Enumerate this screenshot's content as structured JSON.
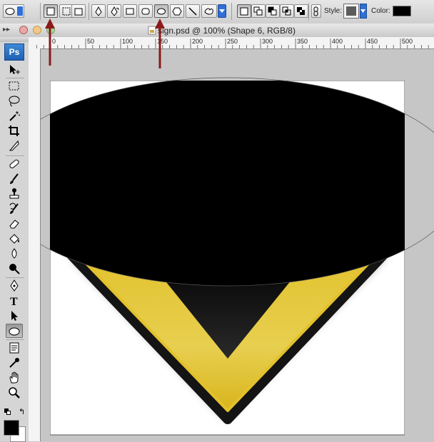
{
  "document": {
    "title": "sign.psd @ 100% (Shape 6, RGB/8)"
  },
  "options_bar": {
    "style_label": "Style:",
    "color_label": "Color:",
    "active_shape": "ellipse",
    "colors": {
      "style_swatch": "#5c5c5c",
      "color_swatch": "#000000"
    },
    "icons": [
      "ellipse-tool-preset-icon",
      "shape-layers-icon",
      "paths-icon",
      "fill-pixels-icon",
      "pen-icon",
      "freeform-pen-icon",
      "rectangle-icon",
      "rounded-rectangle-icon",
      "ellipse-icon",
      "polygon-icon",
      "line-icon",
      "custom-shape-icon",
      "create-new-shape-icon",
      "add-to-shape-icon",
      "subtract-icon",
      "intersect-icon",
      "exclude-icon",
      "link-icon"
    ]
  },
  "ruler": {
    "ticks": [
      "0",
      "50",
      "100",
      "150",
      "200",
      "250",
      "300",
      "350",
      "400",
      "450",
      "500"
    ]
  },
  "toolbox": {
    "logo": "Ps",
    "active_tool": "ellipse",
    "foreground_color": "#000000",
    "background_color": "#ffffff",
    "tools": [
      "move",
      "marquee",
      "lasso",
      "magic-wand",
      "crop",
      "slice",
      "healing-brush",
      "brush",
      "clone-stamp",
      "history-brush",
      "eraser",
      "paint-bucket",
      "blur",
      "dodge",
      "pen",
      "type",
      "path-selection",
      "ellipse",
      "notes",
      "eyedropper",
      "hand",
      "zoom"
    ]
  },
  "canvas": {
    "colors": {
      "sign_yellow": "#e3c635",
      "sign_border": "#1a1a1a",
      "ellipse_fill": "#000000"
    }
  }
}
